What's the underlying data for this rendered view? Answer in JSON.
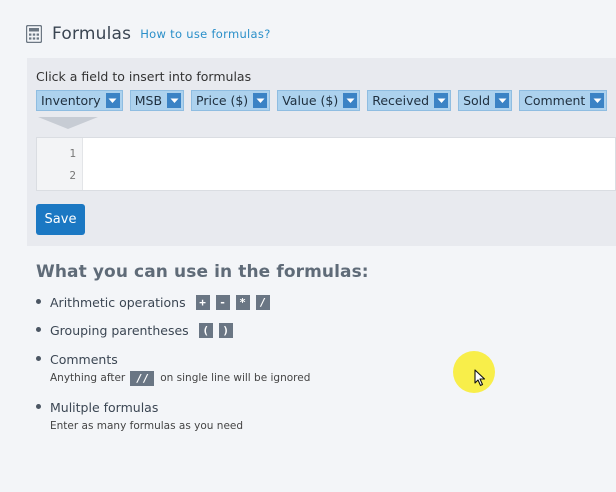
{
  "header": {
    "title": "Formulas",
    "help_link": "How to use formulas?",
    "icon": "calculator-icon"
  },
  "editor_panel": {
    "instruction": "Click a field to insert into formulas",
    "fields": [
      {
        "label": "Inventory"
      },
      {
        "label": "MSB"
      },
      {
        "label": "Price ($)"
      },
      {
        "label": "Value ($)"
      },
      {
        "label": "Received"
      },
      {
        "label": "Sold"
      },
      {
        "label": "Comment"
      }
    ],
    "line_numbers": [
      "1",
      "2"
    ],
    "save_label": "Save"
  },
  "help": {
    "title": "What you can use in the formulas:",
    "items": [
      {
        "label": "Arithmetic operations",
        "symbols": [
          "+",
          "-",
          "*",
          "/"
        ]
      },
      {
        "label": "Grouping parentheses",
        "symbols": [
          "(",
          ")"
        ]
      },
      {
        "label": "Comments",
        "detail_before": "Anything after",
        "symbol": "//",
        "detail_after": "on single line will be ignored"
      },
      {
        "label": "Mulitple formulas",
        "detail": "Enter as many formulas as you need"
      }
    ]
  },
  "colors": {
    "accent": "#1b78c3",
    "field_chip": "#add2ee",
    "cursor_highlight": "#f8ee4a"
  }
}
